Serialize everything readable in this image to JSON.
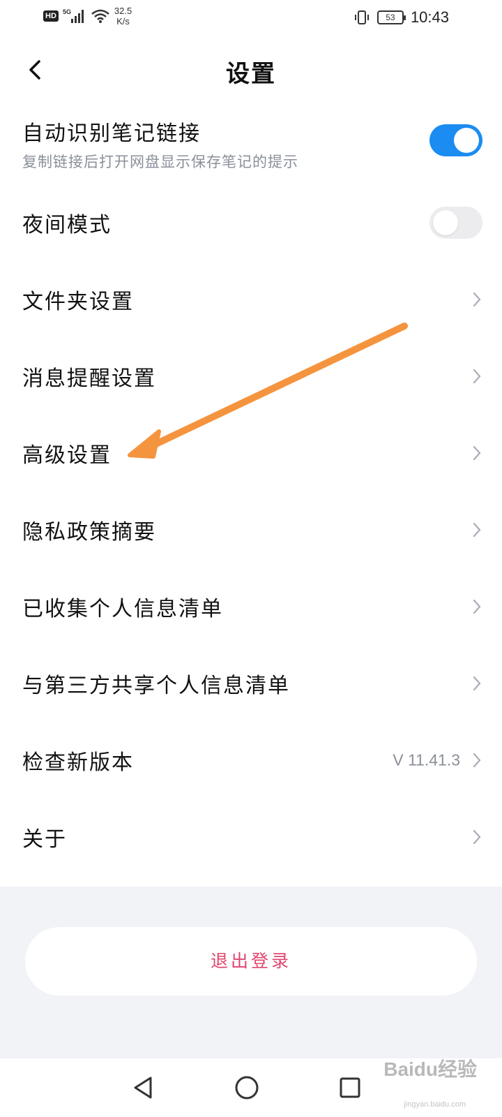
{
  "status_bar": {
    "network_badge": "HD",
    "signal_label": "5G",
    "speed_value": "32.5",
    "speed_unit": "K/s",
    "battery": "53",
    "time": "10:43"
  },
  "header": {
    "title": "设置"
  },
  "settings": {
    "auto_link": {
      "label": "自动识别笔记链接",
      "subtitle": "复制链接后打开网盘显示保存笔记的提示",
      "enabled": true
    },
    "night_mode": {
      "label": "夜间模式",
      "enabled": false
    },
    "items": [
      {
        "label": "文件夹设置"
      },
      {
        "label": "消息提醒设置"
      },
      {
        "label": "高级设置"
      },
      {
        "label": "隐私政策摘要"
      },
      {
        "label": "已收集个人信息清单"
      },
      {
        "label": "与第三方共享个人信息清单"
      },
      {
        "label": "检查新版本",
        "value": "V 11.41.3"
      },
      {
        "label": "关于"
      }
    ]
  },
  "logout_label": "退出登录",
  "watermark": {
    "text": "Baidu经验",
    "sub": "jingyan.baidu.com"
  },
  "colors": {
    "accent": "#1a8cf2",
    "logout": "#e0456e",
    "annotation_arrow": "#f5943e",
    "bottom_bg": "#f2f3f7"
  },
  "icons": {
    "back": "chevron-left-icon",
    "row_arrow": "chevron-right-icon",
    "nav_back": "triangle-back-icon",
    "nav_home": "circle-home-icon",
    "nav_recent": "square-recents-icon"
  }
}
